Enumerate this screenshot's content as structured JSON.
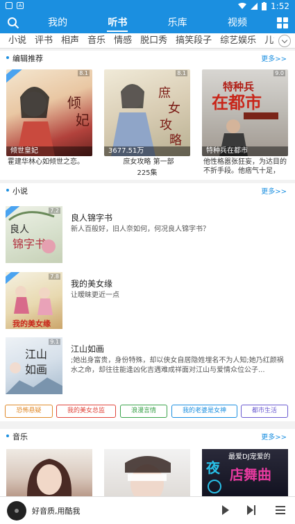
{
  "status_bar": {
    "time": "1:52",
    "left_icons": [
      "notification-icon",
      "app-icon"
    ],
    "right_icons": [
      "wifi-icon",
      "signal-icon",
      "battery-icon"
    ]
  },
  "top_nav": {
    "tabs": [
      {
        "label": "我的"
      },
      {
        "label": "听书",
        "active": true
      },
      {
        "label": "乐库"
      },
      {
        "label": "视频"
      }
    ]
  },
  "categories": [
    "小说",
    "评书",
    "相声",
    "音乐",
    "情感",
    "脱口秀",
    "搞笑段子",
    "综艺娱乐",
    "儿童"
  ],
  "editor_picks": {
    "title": "编辑推荐",
    "more": "更多>>",
    "items": [
      {
        "score": "8.1",
        "overlay": "倾世皇妃",
        "desc": "霍建华林心如倾世之恋。",
        "sub": ""
      },
      {
        "score": "8.1",
        "overlay": "3677.51万",
        "desc": "庶女攻略 第一部",
        "sub": "225集"
      },
      {
        "score": "9.0",
        "overlay": "特种兵在都市",
        "desc": "他性格嚣张狂妄，为达目的不折手段。他痞气十足，",
        "sub": ""
      }
    ]
  },
  "novels": {
    "title": "小说",
    "more": "更多>>",
    "items": [
      {
        "score": "7.2",
        "name": "良人锦字书",
        "intro": "新人百般好，旧人奈如何，何况良人锦字书？"
      },
      {
        "score": "7.8",
        "name": "我的美女缘",
        "intro": "让暧昧更近一点"
      },
      {
        "score": "9.1",
        "name": "江山如画",
        "intro": ";她出身富贵，身份特殊，却以侠女自居隐姓埋名不为人知;她乃红颜祸水之命，却往往能逢凶化吉遇难成祥面对江山与爱情众位公子..."
      }
    ]
  },
  "tags": [
    {
      "label": "恐怖悬疑",
      "color": "#e08a2a"
    },
    {
      "label": "我的美女总监",
      "color": "#e0443a"
    },
    {
      "label": "浪漫言情",
      "color": "#3aa24a"
    },
    {
      "label": "我的老婆是女神",
      "color": "#1b8fe0"
    },
    {
      "label": "都市生活",
      "color": "#6a5ad0"
    }
  ],
  "music": {
    "title": "音乐",
    "more": "更多>>"
  },
  "player": {
    "song": "好音质,用酷我"
  },
  "colors": {
    "brand": "#1b8fe0"
  }
}
